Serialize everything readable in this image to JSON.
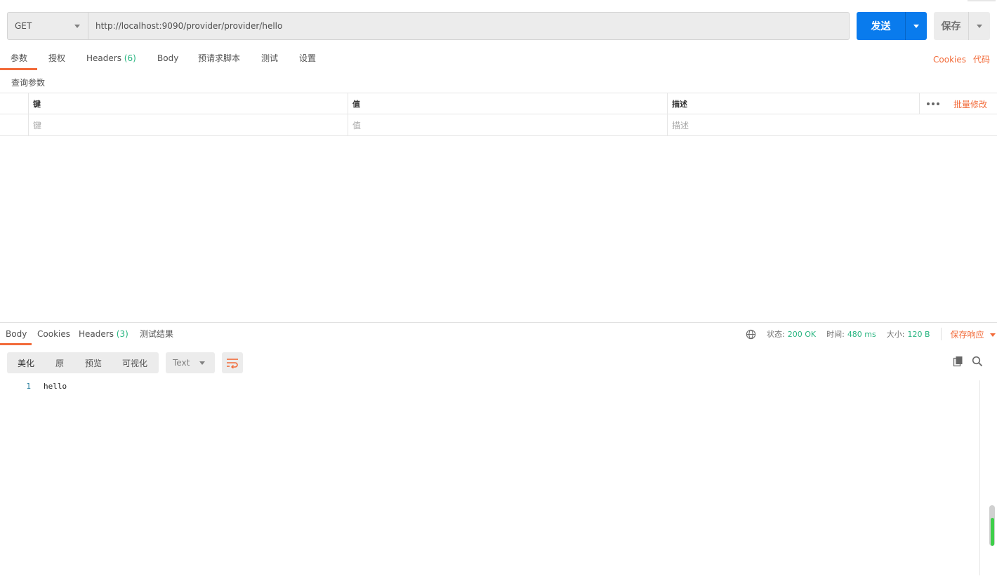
{
  "request": {
    "method": "GET",
    "url": "http://localhost:9090/provider/provider/hello",
    "send_label": "发送",
    "save_label": "保存"
  },
  "request_tabs": [
    {
      "label": "参数",
      "active": true
    },
    {
      "label": "授权"
    },
    {
      "label": "Headers",
      "count": "(6)"
    },
    {
      "label": "Body"
    },
    {
      "label": "预请求脚本"
    },
    {
      "label": "测试"
    },
    {
      "label": "设置"
    }
  ],
  "right_links": {
    "cookies": "Cookies",
    "code": "代码"
  },
  "params": {
    "section_title": "查询参数",
    "headers": {
      "key": "键",
      "value": "值",
      "description": "描述",
      "bulk_edit": "批量修改"
    },
    "placeholders": {
      "key": "键",
      "value": "值",
      "description": "描述"
    }
  },
  "response_tabs": [
    {
      "label": "Body",
      "active": true
    },
    {
      "label": "Cookies"
    },
    {
      "label": "Headers",
      "count": "(3)"
    },
    {
      "label": "测试结果"
    }
  ],
  "status": {
    "status_label": "状态:",
    "status_value": "200 OK",
    "time_label": "时间:",
    "time_value": "480 ms",
    "size_label": "大小:",
    "size_value": "120 B",
    "save_response": "保存响应"
  },
  "format_buttons": [
    {
      "label": "美化",
      "active": true
    },
    {
      "label": "原"
    },
    {
      "label": "预览"
    },
    {
      "label": "可视化"
    }
  ],
  "language": "Text",
  "response_body": {
    "line_number": "1",
    "content": "hello"
  },
  "colors": {
    "accent": "#f26b3a",
    "primary": "#097bed",
    "success": "#26b47f"
  },
  "icons": [
    "chevron-down-icon",
    "more-dots-icon",
    "globe-icon",
    "wrap-lines-icon",
    "copy-icon",
    "search-icon"
  ]
}
